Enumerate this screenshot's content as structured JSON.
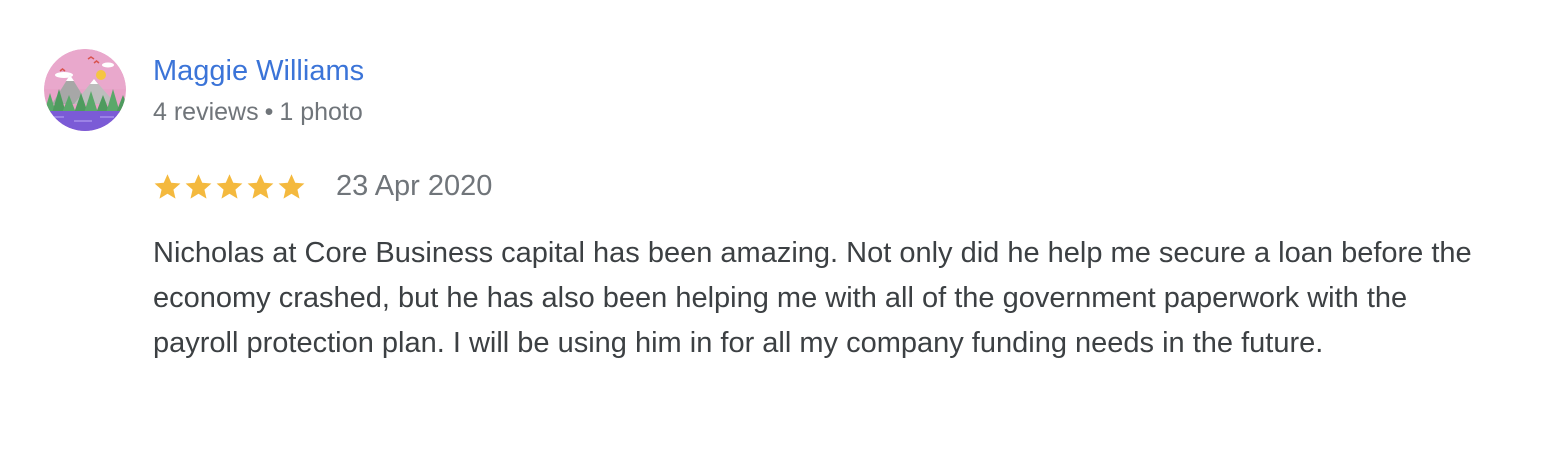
{
  "review": {
    "author": {
      "name": "Maggie Williams",
      "review_count": "4 reviews",
      "separator": "•",
      "photo_count": "1 photo",
      "avatar_icon": "landscape-avatar-icon"
    },
    "rating": {
      "stars": 5,
      "max_stars": 5,
      "star_color": "#f4b93e"
    },
    "date": "23 Apr 2020",
    "text": "Nicholas at Core Business capital has been amazing. Not only did he help me secure a loan before the economy crashed, but he has also been helping me with all of the government paperwork with the payroll protection plan. I will be using him in for all my company funding needs in the future."
  },
  "colors": {
    "author_link": "#3b74d8",
    "meta_text": "#70757a",
    "body_text": "#3c4043",
    "background": "#ffffff"
  }
}
